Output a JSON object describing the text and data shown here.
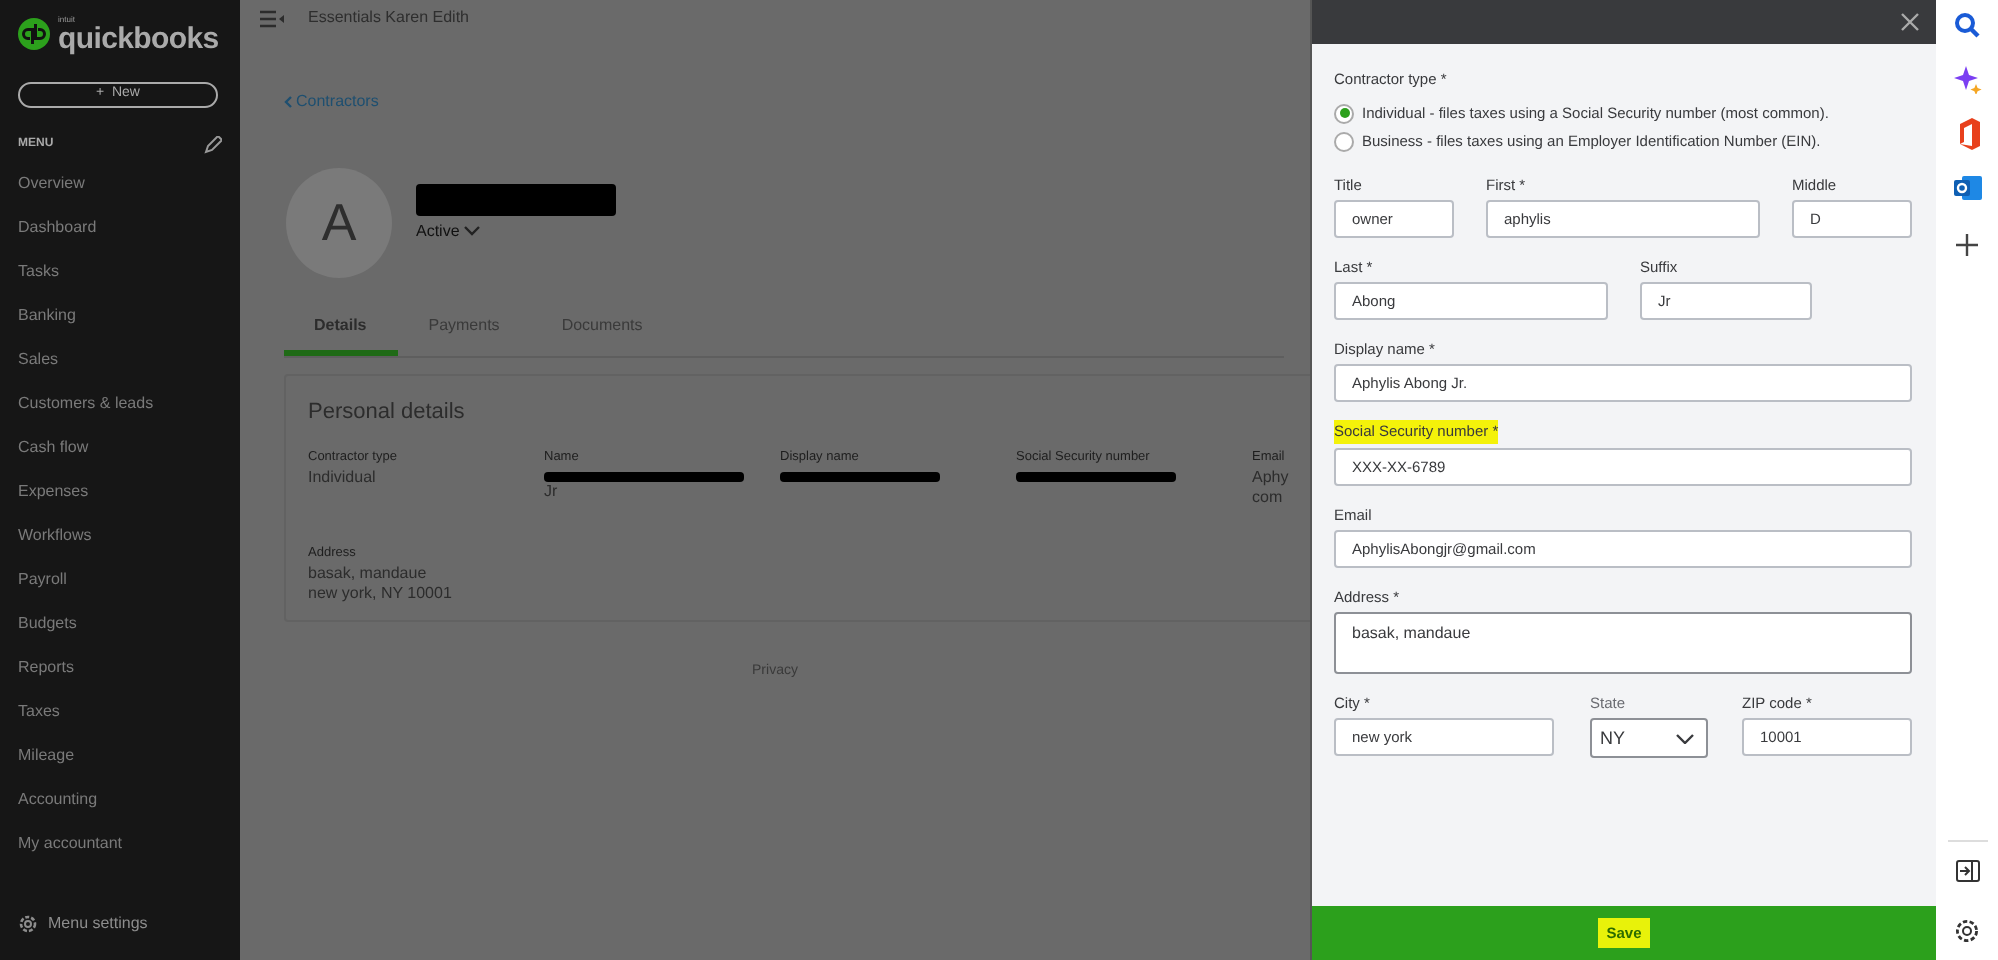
{
  "sidebar": {
    "logo_brand": "intuit",
    "logo_text": "quickbooks",
    "new_button": {
      "icon": "+",
      "label": "New"
    },
    "menu_title": "MENU",
    "items": [
      "Overview",
      "Dashboard",
      "Tasks",
      "Banking",
      "Sales",
      "Customers & leads",
      "Cash flow",
      "Expenses",
      "Workflows",
      "Payroll",
      "Budgets",
      "Reports",
      "Taxes",
      "Mileage",
      "Accounting",
      "My accountant"
    ],
    "settings": "Menu settings"
  },
  "topbar": {
    "company": "Essentials Karen Edith"
  },
  "profile": {
    "back_link": "Contractors",
    "avatar_letter": "A",
    "status": "Active",
    "tabs": [
      {
        "label": "Details",
        "selected": true
      },
      {
        "label": "Payments",
        "selected": false
      },
      {
        "label": "Documents",
        "selected": false
      }
    ],
    "card": {
      "title": "Personal details",
      "fields": [
        {
          "label": "Contractor type",
          "lines": [
            "Individual"
          ]
        },
        {
          "label": "Name",
          "lines": [
            "Jr"
          ],
          "redacted": true
        },
        {
          "label": "Display name",
          "redacted": true
        },
        {
          "label": "Social Security number",
          "redacted": true
        },
        {
          "label": "Email",
          "lines": [
            "Aphy",
            "com"
          ]
        }
      ],
      "address": {
        "label": "Address",
        "lines": [
          "basak, mandaue",
          "new york, NY 10001"
        ]
      }
    },
    "footer": "Privacy"
  },
  "panel": {
    "contractor_type": {
      "label": "Contractor type *",
      "options": [
        {
          "label": "Individual - files taxes using a Social Security number (most common).",
          "selected": true
        },
        {
          "label": "Business - files taxes using an Employer Identification Number (EIN).",
          "selected": false
        }
      ]
    },
    "rows": [
      [
        {
          "label": "Title",
          "value": "owner"
        },
        {
          "label": "First *",
          "value": "aphylis"
        },
        {
          "label": "Middle",
          "value": "D"
        }
      ],
      [
        {
          "label": "Last *",
          "value": "Abong"
        },
        {
          "label": "Suffix",
          "value": "Jr"
        }
      ],
      [
        {
          "label": "Display name *",
          "value": "Aphylis Abong Jr."
        }
      ],
      [
        {
          "label": "Social Security number *",
          "value": "XXX-XX-6789",
          "highlighted": true
        }
      ],
      [
        {
          "label": "Email",
          "value": "AphylisAbongjr@gmail.com"
        }
      ],
      [
        {
          "label": "Address *",
          "value": "basak, mandaue",
          "kind": "textarea"
        }
      ],
      [
        {
          "label": "City *",
          "value": "new york"
        },
        {
          "label": "State",
          "value": "NY",
          "kind": "select"
        },
        {
          "label": "ZIP code *",
          "value": "10001"
        }
      ]
    ],
    "save": {
      "label": "Save",
      "highlighted": true
    }
  }
}
